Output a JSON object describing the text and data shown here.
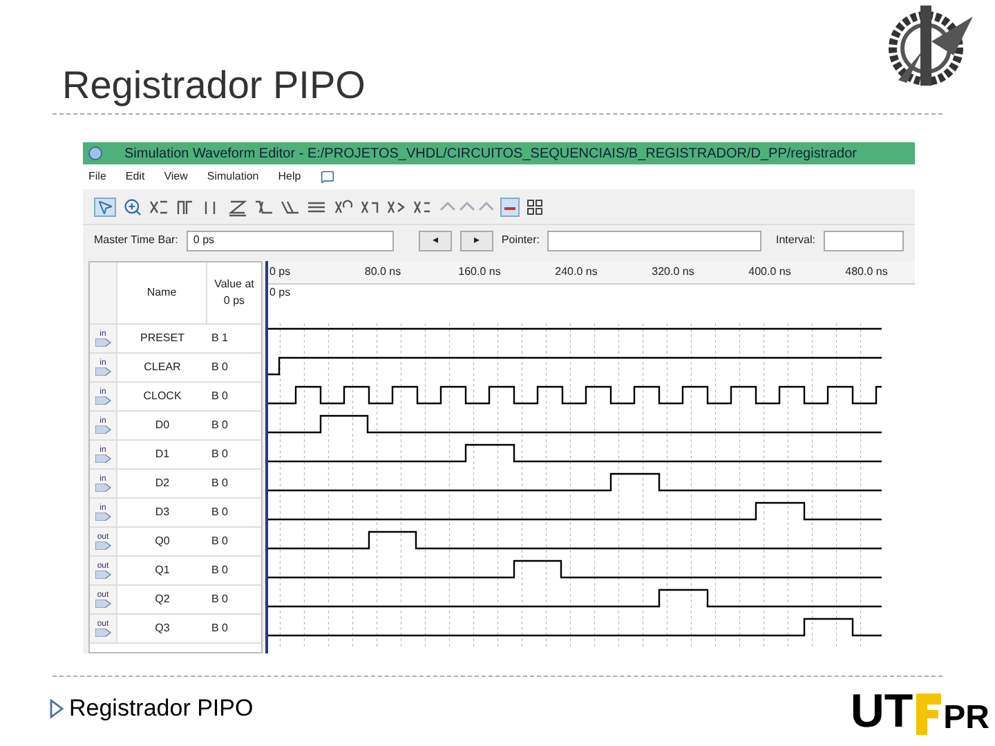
{
  "slide_title": "Registrador PIPO",
  "window": {
    "title": "Simulation Waveform Editor - E:/PROJETOS_VHDL/CIRCUITOS_SEQUENCIAIS/B_REGISTRADOR/D_PP/registrador"
  },
  "menu": [
    "File",
    "Edit",
    "View",
    "Simulation",
    "Help"
  ],
  "time_bar": {
    "master_label": "Master Time Bar:",
    "master_value": "0 ps",
    "prev": "◂",
    "next": "▸",
    "pointer_label": "Pointer:",
    "interval_label": "Interval:"
  },
  "table": {
    "columns": [
      "Name",
      "Value at\n0 ps"
    ],
    "signals": [
      {
        "io": "in",
        "name": "PRESET",
        "value": "B 1"
      },
      {
        "io": "in",
        "name": "CLEAR",
        "value": "B 0"
      },
      {
        "io": "in",
        "name": "CLOCK",
        "value": "B 0"
      },
      {
        "io": "in",
        "name": "D0",
        "value": "B 0"
      },
      {
        "io": "in",
        "name": "D1",
        "value": "B 0"
      },
      {
        "io": "in",
        "name": "D2",
        "value": "B 0"
      },
      {
        "io": "in",
        "name": "D3",
        "value": "B 0"
      },
      {
        "io": "out",
        "name": "Q0",
        "value": "B 0"
      },
      {
        "io": "out",
        "name": "Q1",
        "value": "B 0"
      },
      {
        "io": "out",
        "name": "Q2",
        "value": "B 0"
      },
      {
        "io": "out",
        "name": "Q3",
        "value": "B 0"
      }
    ]
  },
  "timeline": {
    "ticks": [
      "0 ps",
      "80.0 ns",
      "160.0 ns",
      "240.0 ns",
      "320.0 ns",
      "400.0 ns",
      "480.0 ns"
    ],
    "cursor": "0 ps"
  },
  "caption": "Registrador PIPO",
  "logo": {
    "left": "UT",
    "right": "PR"
  }
}
